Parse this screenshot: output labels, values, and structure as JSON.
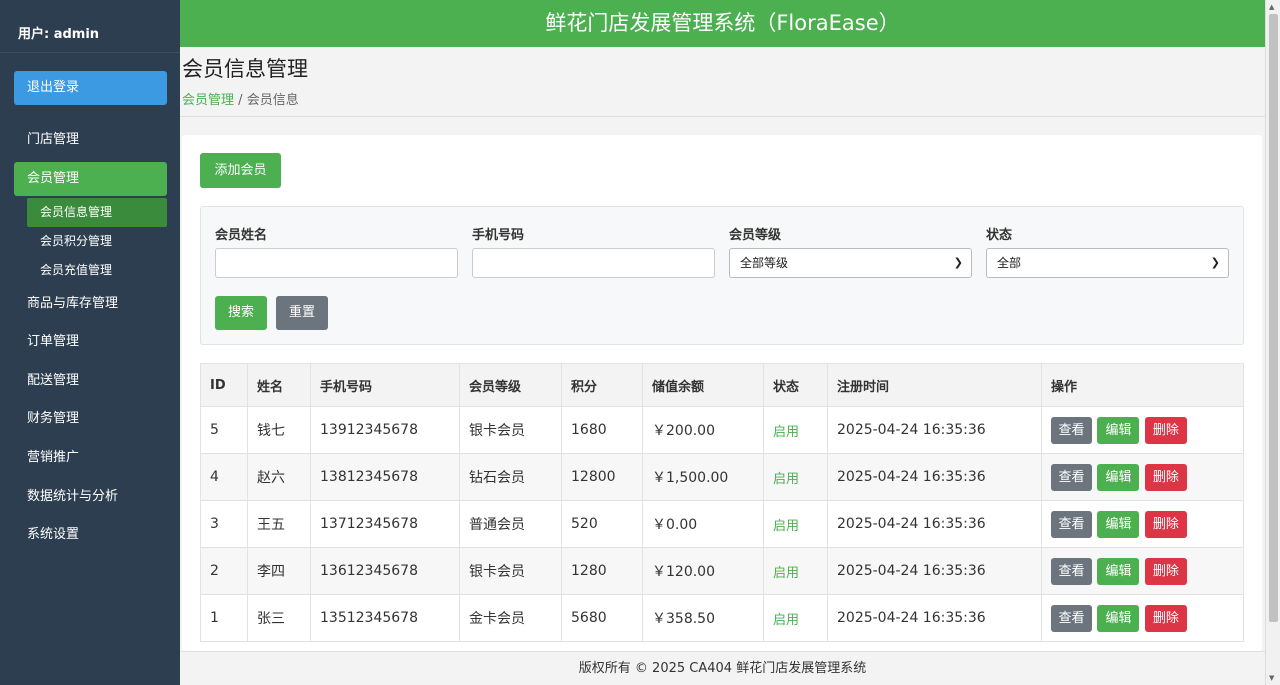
{
  "user": "用户: admin",
  "logout_label": "退出登录",
  "menu": [
    {
      "label": "门店管理"
    },
    {
      "label": "会员管理"
    },
    {
      "label": "商品与库存管理"
    },
    {
      "label": "订单管理"
    },
    {
      "label": "配送管理"
    },
    {
      "label": "财务管理"
    },
    {
      "label": "营销推广"
    },
    {
      "label": "数据统计与分析"
    },
    {
      "label": "系统设置"
    }
  ],
  "submenu": [
    {
      "label": "会员信息管理"
    },
    {
      "label": "会员积分管理"
    },
    {
      "label": "会员充值管理"
    }
  ],
  "header_title": "鲜花门店发展管理系统（FloraEase）",
  "page_title": "会员信息管理",
  "breadcrumb": {
    "parent": "会员管理",
    "sep": "/",
    "current": "会员信息"
  },
  "add_label": "添加会员",
  "filters": {
    "name_label": "会员姓名",
    "phone_label": "手机号码",
    "level_label": "会员等级",
    "level_value": "全部等级",
    "status_label": "状态",
    "status_value": "全部",
    "search_label": "搜索",
    "reset_label": "重置"
  },
  "table": {
    "headers": [
      "ID",
      "姓名",
      "手机号码",
      "会员等级",
      "积分",
      "储值余额",
      "状态",
      "注册时间",
      "操作"
    ],
    "rows": [
      {
        "id": "5",
        "name": "钱七",
        "phone": "13912345678",
        "level": "银卡会员",
        "points": "1680",
        "balance": "￥200.00",
        "status": "启用",
        "time": "2025-04-24 16:35:36"
      },
      {
        "id": "4",
        "name": "赵六",
        "phone": "13812345678",
        "level": "钻石会员",
        "points": "12800",
        "balance": "￥1,500.00",
        "status": "启用",
        "time": "2025-04-24 16:35:36"
      },
      {
        "id": "3",
        "name": "王五",
        "phone": "13712345678",
        "level": "普通会员",
        "points": "520",
        "balance": "￥0.00",
        "status": "启用",
        "time": "2025-04-24 16:35:36"
      },
      {
        "id": "2",
        "name": "李四",
        "phone": "13612345678",
        "level": "银卡会员",
        "points": "1280",
        "balance": "￥120.00",
        "status": "启用",
        "time": "2025-04-24 16:35:36"
      },
      {
        "id": "1",
        "name": "张三",
        "phone": "13512345678",
        "level": "金卡会员",
        "points": "5680",
        "balance": "￥358.50",
        "status": "启用",
        "time": "2025-04-24 16:35:36"
      }
    ],
    "actions": {
      "view": "查看",
      "edit": "编辑",
      "delete": "删除"
    }
  },
  "footer": "版权所有 © 2025 CA404 鲜花门店发展管理系统"
}
